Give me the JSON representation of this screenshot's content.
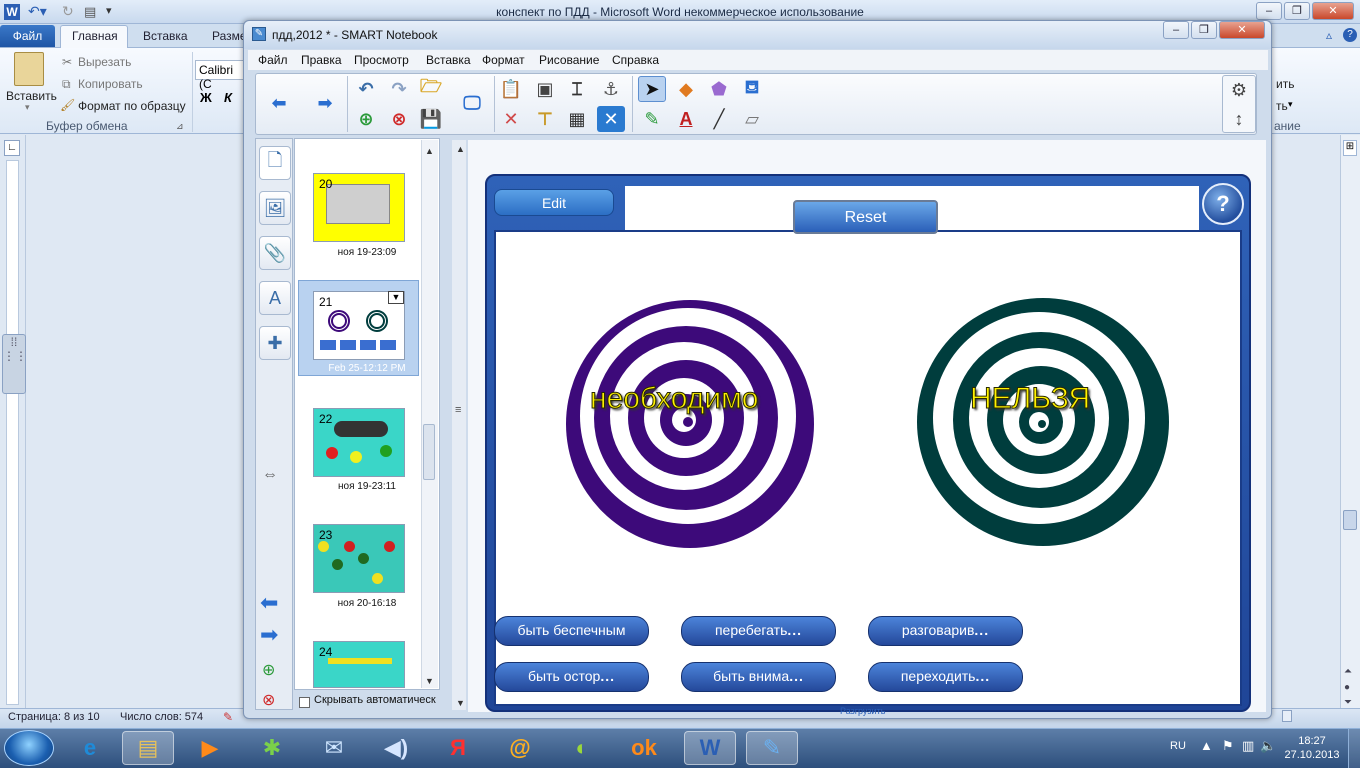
{
  "word": {
    "title": "конспект по ПДД  -  Microsoft Word некоммерческое использование",
    "tabs": {
      "file": "Файл",
      "home": "Главная",
      "insert": "Вставка",
      "layout": "Разме"
    },
    "ribbon": {
      "paste": "Вставить",
      "cut": "Вырезать",
      "copy": "Копировать",
      "format_painter": "Формат по образцу",
      "clipboard_group": "Буфер обмена",
      "font_name": "Calibri (С",
      "bold": "Ж",
      "italic": "К",
      "right_1": "ить",
      "right_2": "ть",
      "right_3": "ание"
    },
    "status": {
      "page": "Страница: 8 из 10",
      "words": "Число слов: 574"
    }
  },
  "taskbar": {
    "lang": "RU",
    "time": "18:27",
    "date": "27.10.2013"
  },
  "smart": {
    "title": "пдд,2012 * - SMART Notebook",
    "menu": [
      "Файл",
      "Правка",
      "Просмотр",
      "Вставка",
      "Формат",
      "Рисование",
      "Справка"
    ],
    "slides": [
      {
        "num": "20",
        "label": "ноя 19-23:09"
      },
      {
        "num": "21",
        "label": "Feb 25-12:12 PM"
      },
      {
        "num": "22",
        "label": "ноя 19-23:11"
      },
      {
        "num": "23",
        "label": "ноя 20-16:18"
      },
      {
        "num": "24",
        "label": ""
      }
    ],
    "autohide": "Скрывать автоматическ",
    "activity": {
      "edit": "Edit",
      "reset": "Reset",
      "help": "?",
      "left_label": "необходимо",
      "right_label": "НЕЛЬЗЯ",
      "left_color": "#3d0a7a",
      "right_color": "#003d3d",
      "words": [
        {
          "text": "быть беспечным",
          "dots": ""
        },
        {
          "text": "перебегать",
          "dots": "..."
        },
        {
          "text": "разговарив",
          "dots": "..."
        },
        {
          "text": "быть остор",
          "dots": "..."
        },
        {
          "text": "быть внима",
          "dots": "..."
        },
        {
          "text": "переходить",
          "dots": "..."
        }
      ],
      "bottom_link": "Разгрузить"
    }
  }
}
